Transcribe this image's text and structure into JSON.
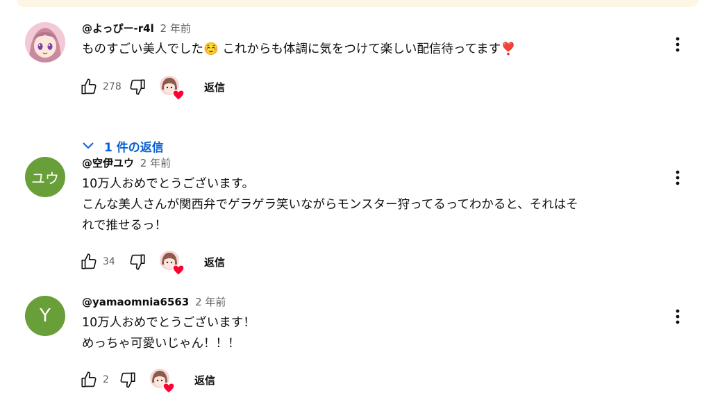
{
  "comments": [
    {
      "author": "@よっぴー-r4l",
      "time": "2 年前",
      "text": "ものすごい美人でした☺️ これからも体調に気をつけて楽しい配信待ってます❣️",
      "likes": "278",
      "reply_label": "返信",
      "avatar_type": "illustration",
      "replies_toggle": "1 件の返信"
    },
    {
      "author": "@空伊ユウ",
      "time": "2 年前",
      "text": "10万人おめでとうございます。\nこんな美人さんが関西弁でゲラゲラ笑いながらモンスター狩ってるってわかると、それはそ\nれで推せるっ！",
      "likes": "34",
      "reply_label": "返信",
      "avatar_type": "letter",
      "avatar_letter": "ユウ",
      "avatar_color": "#689f38"
    },
    {
      "author": "@yamaomnia6563",
      "time": "2 年前",
      "text": "10万人おめでとうございます！\nめっちゃ可愛いじゃん！！！",
      "likes": "2",
      "reply_label": "返信",
      "avatar_type": "letter",
      "avatar_letter": "Y",
      "avatar_color": "#689f38"
    }
  ],
  "colors": {
    "link_blue": "#065fd4",
    "secondary_text": "#606060",
    "heart_red": "#ff0033",
    "top_strip": "#fdf6e4"
  }
}
